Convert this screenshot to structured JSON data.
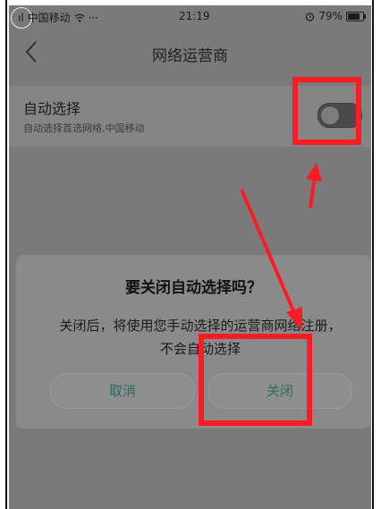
{
  "status_bar": {
    "carrier": "中国移动",
    "signal_glyphs": "ıl",
    "more": "···",
    "time": "21:19",
    "battery_percent_label": "79%",
    "battery_level": 0.79,
    "alarm_icon": "alarm-icon",
    "wifi_icon": "wifi-icon"
  },
  "header": {
    "title": "网络运营商",
    "back_icon": "chevron-left-icon"
  },
  "setting": {
    "title": "自动选择",
    "subtitle": "自动选择首选网络,中国移动",
    "toggle_on": false
  },
  "dialog": {
    "title": "要关闭自动选择吗？",
    "message": "关闭后，将使用您手动选择的运营商网络注册，不会自动选择",
    "cancel_label": "取消",
    "close_label": "关闭"
  },
  "colors": {
    "highlight_red": "#ff1a24",
    "button_text": "#2a6b62",
    "overlay_gray": "#7a7a7a"
  }
}
